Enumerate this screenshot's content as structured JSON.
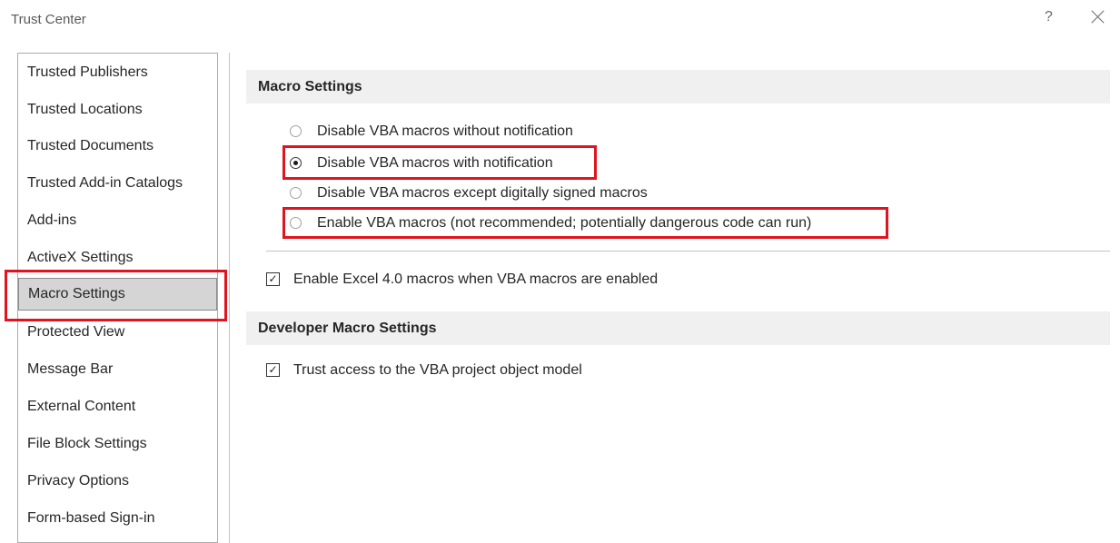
{
  "window": {
    "title": "Trust Center",
    "help_glyph": "?",
    "close_icon": "close-icon"
  },
  "sidebar": {
    "items": [
      {
        "label": "Trusted Publishers"
      },
      {
        "label": "Trusted Locations"
      },
      {
        "label": "Trusted Documents"
      },
      {
        "label": "Trusted Add-in Catalogs"
      },
      {
        "label": "Add-ins"
      },
      {
        "label": "ActiveX Settings"
      },
      {
        "label": "Macro Settings",
        "selected": true
      },
      {
        "label": "Protected View"
      },
      {
        "label": "Message Bar"
      },
      {
        "label": "External Content"
      },
      {
        "label": "File Block Settings"
      },
      {
        "label": "Privacy Options"
      },
      {
        "label": "Form-based Sign-in"
      }
    ]
  },
  "macro_settings": {
    "heading": "Macro Settings",
    "options": [
      {
        "label": "Disable VBA macros without notification",
        "selected": false
      },
      {
        "label": "Disable VBA macros with notification",
        "selected": true
      },
      {
        "label": "Disable VBA macros except digitally signed macros",
        "selected": false
      },
      {
        "label": "Enable VBA macros (not recommended; potentially dangerous code can run)",
        "selected": false
      }
    ],
    "excel4_checkbox": {
      "label": "Enable Excel 4.0 macros when VBA macros are enabled",
      "checked": true
    }
  },
  "developer_settings": {
    "heading": "Developer Macro Settings",
    "vba_access_checkbox": {
      "label": "Trust access to the VBA project object model",
      "checked": true
    }
  },
  "colors": {
    "highlight": "#e0141e",
    "selected_bg": "#d5d5d5",
    "section_bg": "#f0f0f0"
  }
}
